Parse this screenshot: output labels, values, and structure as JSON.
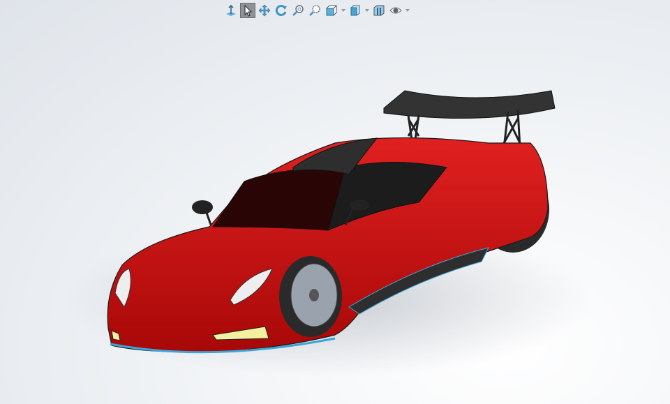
{
  "toolbar": {
    "items": [
      {
        "icon": "normal-to-icon",
        "active": false
      },
      {
        "icon": "select-arrow-icon",
        "active": true
      },
      {
        "icon": "pan-icon",
        "active": false
      },
      {
        "icon": "rotate-icon",
        "active": false
      },
      {
        "icon": "zoom-to-fit-icon",
        "active": false
      },
      {
        "icon": "zoom-to-area-icon",
        "active": false
      },
      {
        "icon": "view-orientation-icon",
        "active": false,
        "dropdown": true
      },
      {
        "icon": "display-style-icon",
        "active": false,
        "dropdown": true
      },
      {
        "icon": "section-view-icon",
        "active": false
      },
      {
        "icon": "hide-show-items-icon",
        "active": false,
        "dropdown": true
      }
    ]
  },
  "model": {
    "body_color": "#d10f0f",
    "trim_color": "#2e2e2e",
    "edge_color": "#1a1a1a",
    "highlight_edge_color": "#3aa6d8",
    "headlight_color": "#f3f0a0"
  }
}
